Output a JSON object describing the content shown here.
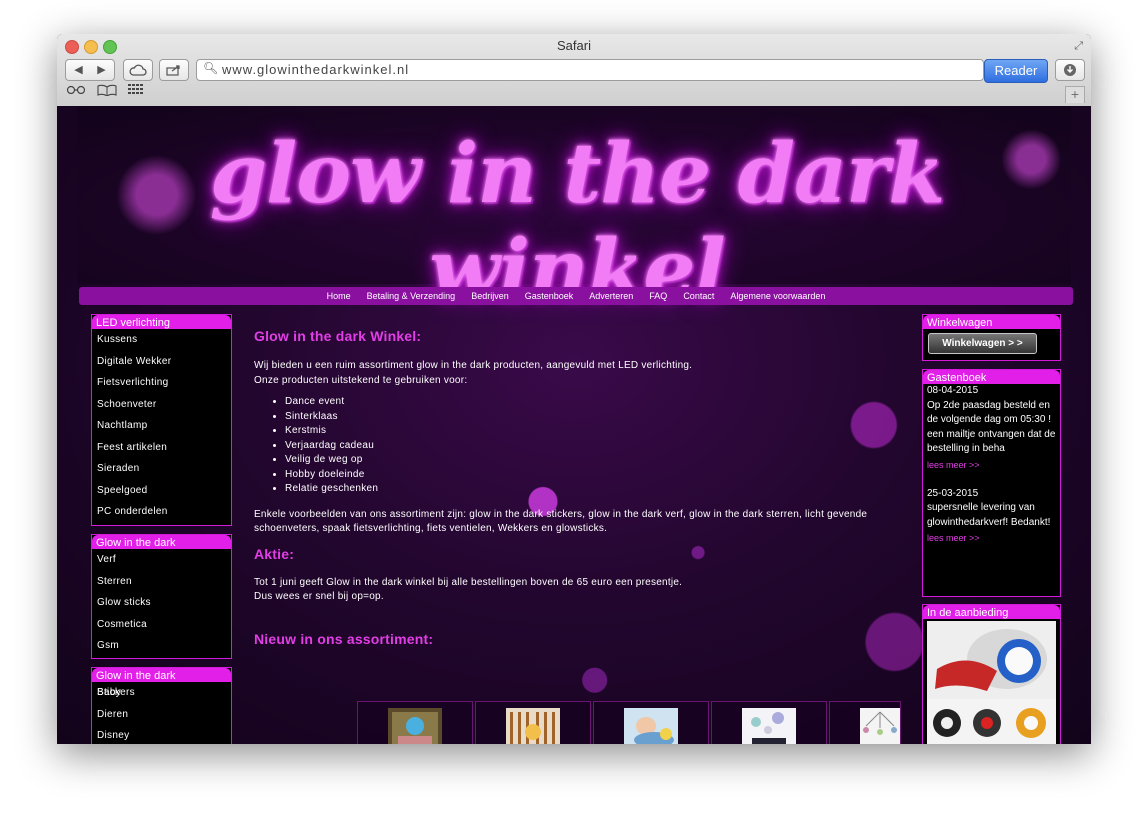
{
  "browser": {
    "title": "Safari",
    "url": "www.glowinthedarkwinkel.nl",
    "reader_label": "Reader"
  },
  "site": {
    "logo_text": "glow in the dark winkel",
    "nav": [
      "Home",
      "Betaling & Verzending",
      "Bedrijven",
      "Gastenboek",
      "Adverteren",
      "FAQ",
      "Contact",
      "Algemene voorwaarden"
    ]
  },
  "sidebar": {
    "led": {
      "title": "LED verlichting",
      "items": [
        "Kussens",
        "Digitale Wekker",
        "Fietsverlichting",
        "Schoenveter",
        "Nachtlamp",
        "Feest artikelen",
        "Sieraden",
        "Speelgoed",
        "PC onderdelen"
      ]
    },
    "glow": {
      "title": "Glow in the dark",
      "items": [
        "Verf",
        "Sterren",
        "Glow sticks",
        "Cosmetica",
        "Gsm"
      ]
    },
    "glow2": {
      "title": "Glow in the dark",
      "overlap": "Baby",
      "items": [
        "Stickers",
        "Dieren",
        "Disney"
      ]
    }
  },
  "main": {
    "heading": "Glow in the dark Winkel:",
    "intro1": "Wij bieden u een ruim assortiment glow in the dark producten, aangevuld met LED verlichting.",
    "intro2": "Onze producten uitstekend te gebruiken voor:",
    "uses": [
      "Dance event",
      "Sinterklaas",
      "Kerstmis",
      "Verjaardag cadeau",
      "Veilig de weg op",
      "Hobby doeleinde",
      "Relatie geschenken"
    ],
    "examples": "Enkele voorbeelden van ons assortiment zijn: glow in the dark stickers, glow in the dark verf, glow in the dark sterren, licht gevende schoenveters, spaak fietsverlichting, fiets ventielen, Wekkers en glowsticks.",
    "aktie_heading": "Aktie:",
    "aktie1": "Tot 1 juni geeft Glow in the dark winkel bij alle bestellingen boven de 65 euro een presentje.",
    "aktie2": "Dus wees er snel bij op=op.",
    "nieuw_heading": "Nieuw in ons assortiment:"
  },
  "right": {
    "cart": {
      "title": "Winkelwagen",
      "button": "Winkelwagen > >"
    },
    "guestbook": {
      "title": "Gastenboek",
      "entries": [
        {
          "date": "08-04-2015",
          "text": "Op 2de paasdag besteld en de volgende dag om 05:30 ! een mailtje ontvangen dat de bestelling in beha",
          "more": "lees meer >>"
        },
        {
          "date": "25-03-2015",
          "text": "supersnelle levering van glowinthedarkverf! Bedankt!",
          "more": "lees meer >>"
        }
      ]
    },
    "offer": {
      "title": "In de aanbieding"
    }
  }
}
